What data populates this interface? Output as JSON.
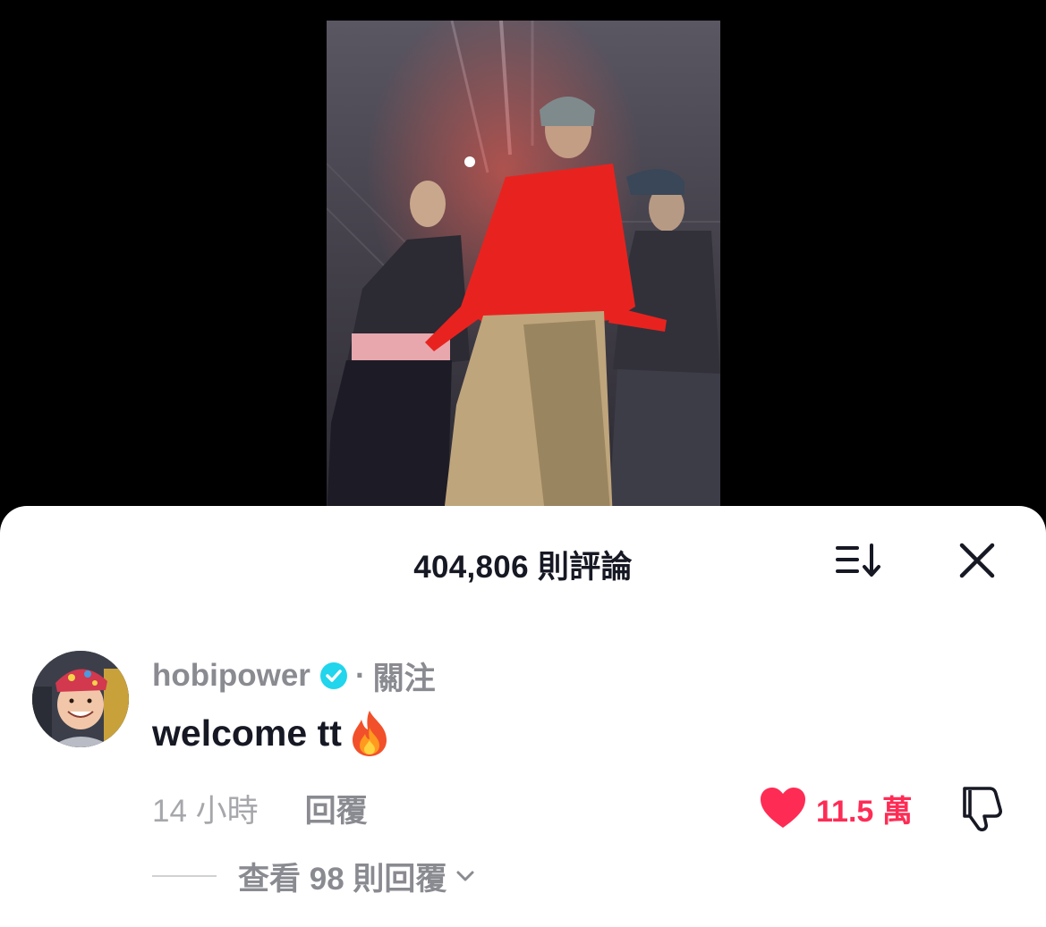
{
  "video": {
    "description_icon": "video-frame"
  },
  "comments_sheet": {
    "title": "404,806 則評論",
    "sort_icon": "sort-icon",
    "close_icon": "close-icon"
  },
  "comment": {
    "username": "hobipower",
    "verified_icon": "verified-badge-icon",
    "separator": "·",
    "follow_label": "關注",
    "text": "welcome tt",
    "emoji_icon": "fire-icon",
    "time": "14 小時",
    "reply_label": "回覆",
    "like_count": "11.5 萬",
    "liked": true,
    "view_replies_label": "查看 98 則回覆"
  },
  "colors": {
    "accent_red": "#fe2c55",
    "text_primary": "#161823",
    "text_secondary": "#8a8b91",
    "verified_blue": "#20d5ec"
  }
}
